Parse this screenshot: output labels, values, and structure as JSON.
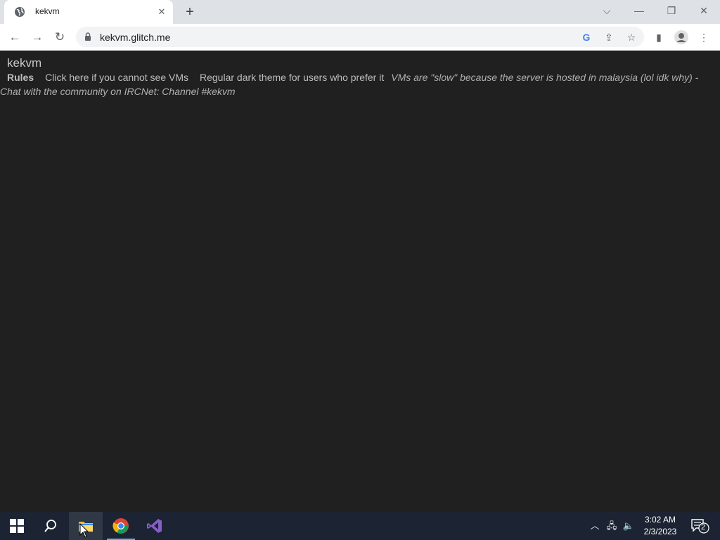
{
  "browser": {
    "tab_title": "kekvm",
    "url": "kekvm.glitch.me",
    "new_tab_symbol": "+",
    "close_symbol": "✕"
  },
  "page": {
    "site_title": "kekvm",
    "nav": {
      "rules": "Rules",
      "cannot_see": "Click here if you cannot see VMs",
      "dark_theme": "Regular dark theme for users who prefer it",
      "slow_note": "VMs are \"slow\" because the server is hosted in malaysia (lol idk why) -",
      "community": "Chat with the community on IRCNet: Channel #kekvm"
    }
  },
  "taskbar": {
    "time": "3:02 AM",
    "date": "2/3/2023",
    "notification_count": "2"
  },
  "colors": {
    "page_bg": "#202020",
    "tabstrip_bg": "#dee1e6",
    "taskbar_bg": "#1c2433"
  }
}
